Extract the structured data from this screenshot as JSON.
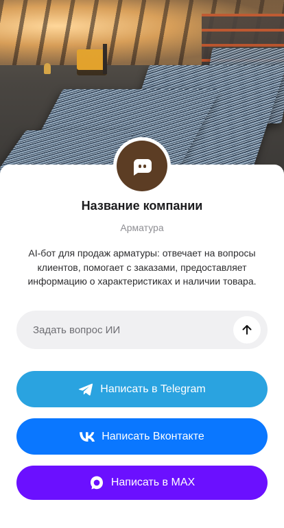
{
  "company": {
    "name": "Название компании",
    "category": "Арматура",
    "description": "AI-бот для продаж арматуры: отвечает на вопросы клиентов, помогает с заказами, предоставляет информацию о характеристиках и наличии товара.",
    "avatar_color": "#5c3d24",
    "avatar_icon": "chat-bubble-icon"
  },
  "ask": {
    "placeholder": "Задать вопрос ИИ",
    "value": "",
    "send_icon": "arrow-up-icon"
  },
  "buttons": {
    "telegram": {
      "label": "Написать в Telegram",
      "color": "#2aa3e0",
      "icon": "telegram-icon"
    },
    "vk": {
      "label": "Написать Вконтакте",
      "color": "#0a77ff",
      "icon": "vk-icon"
    },
    "max": {
      "label": "Написать в MAX",
      "color": "#6b10ff",
      "icon": "max-icon"
    }
  }
}
